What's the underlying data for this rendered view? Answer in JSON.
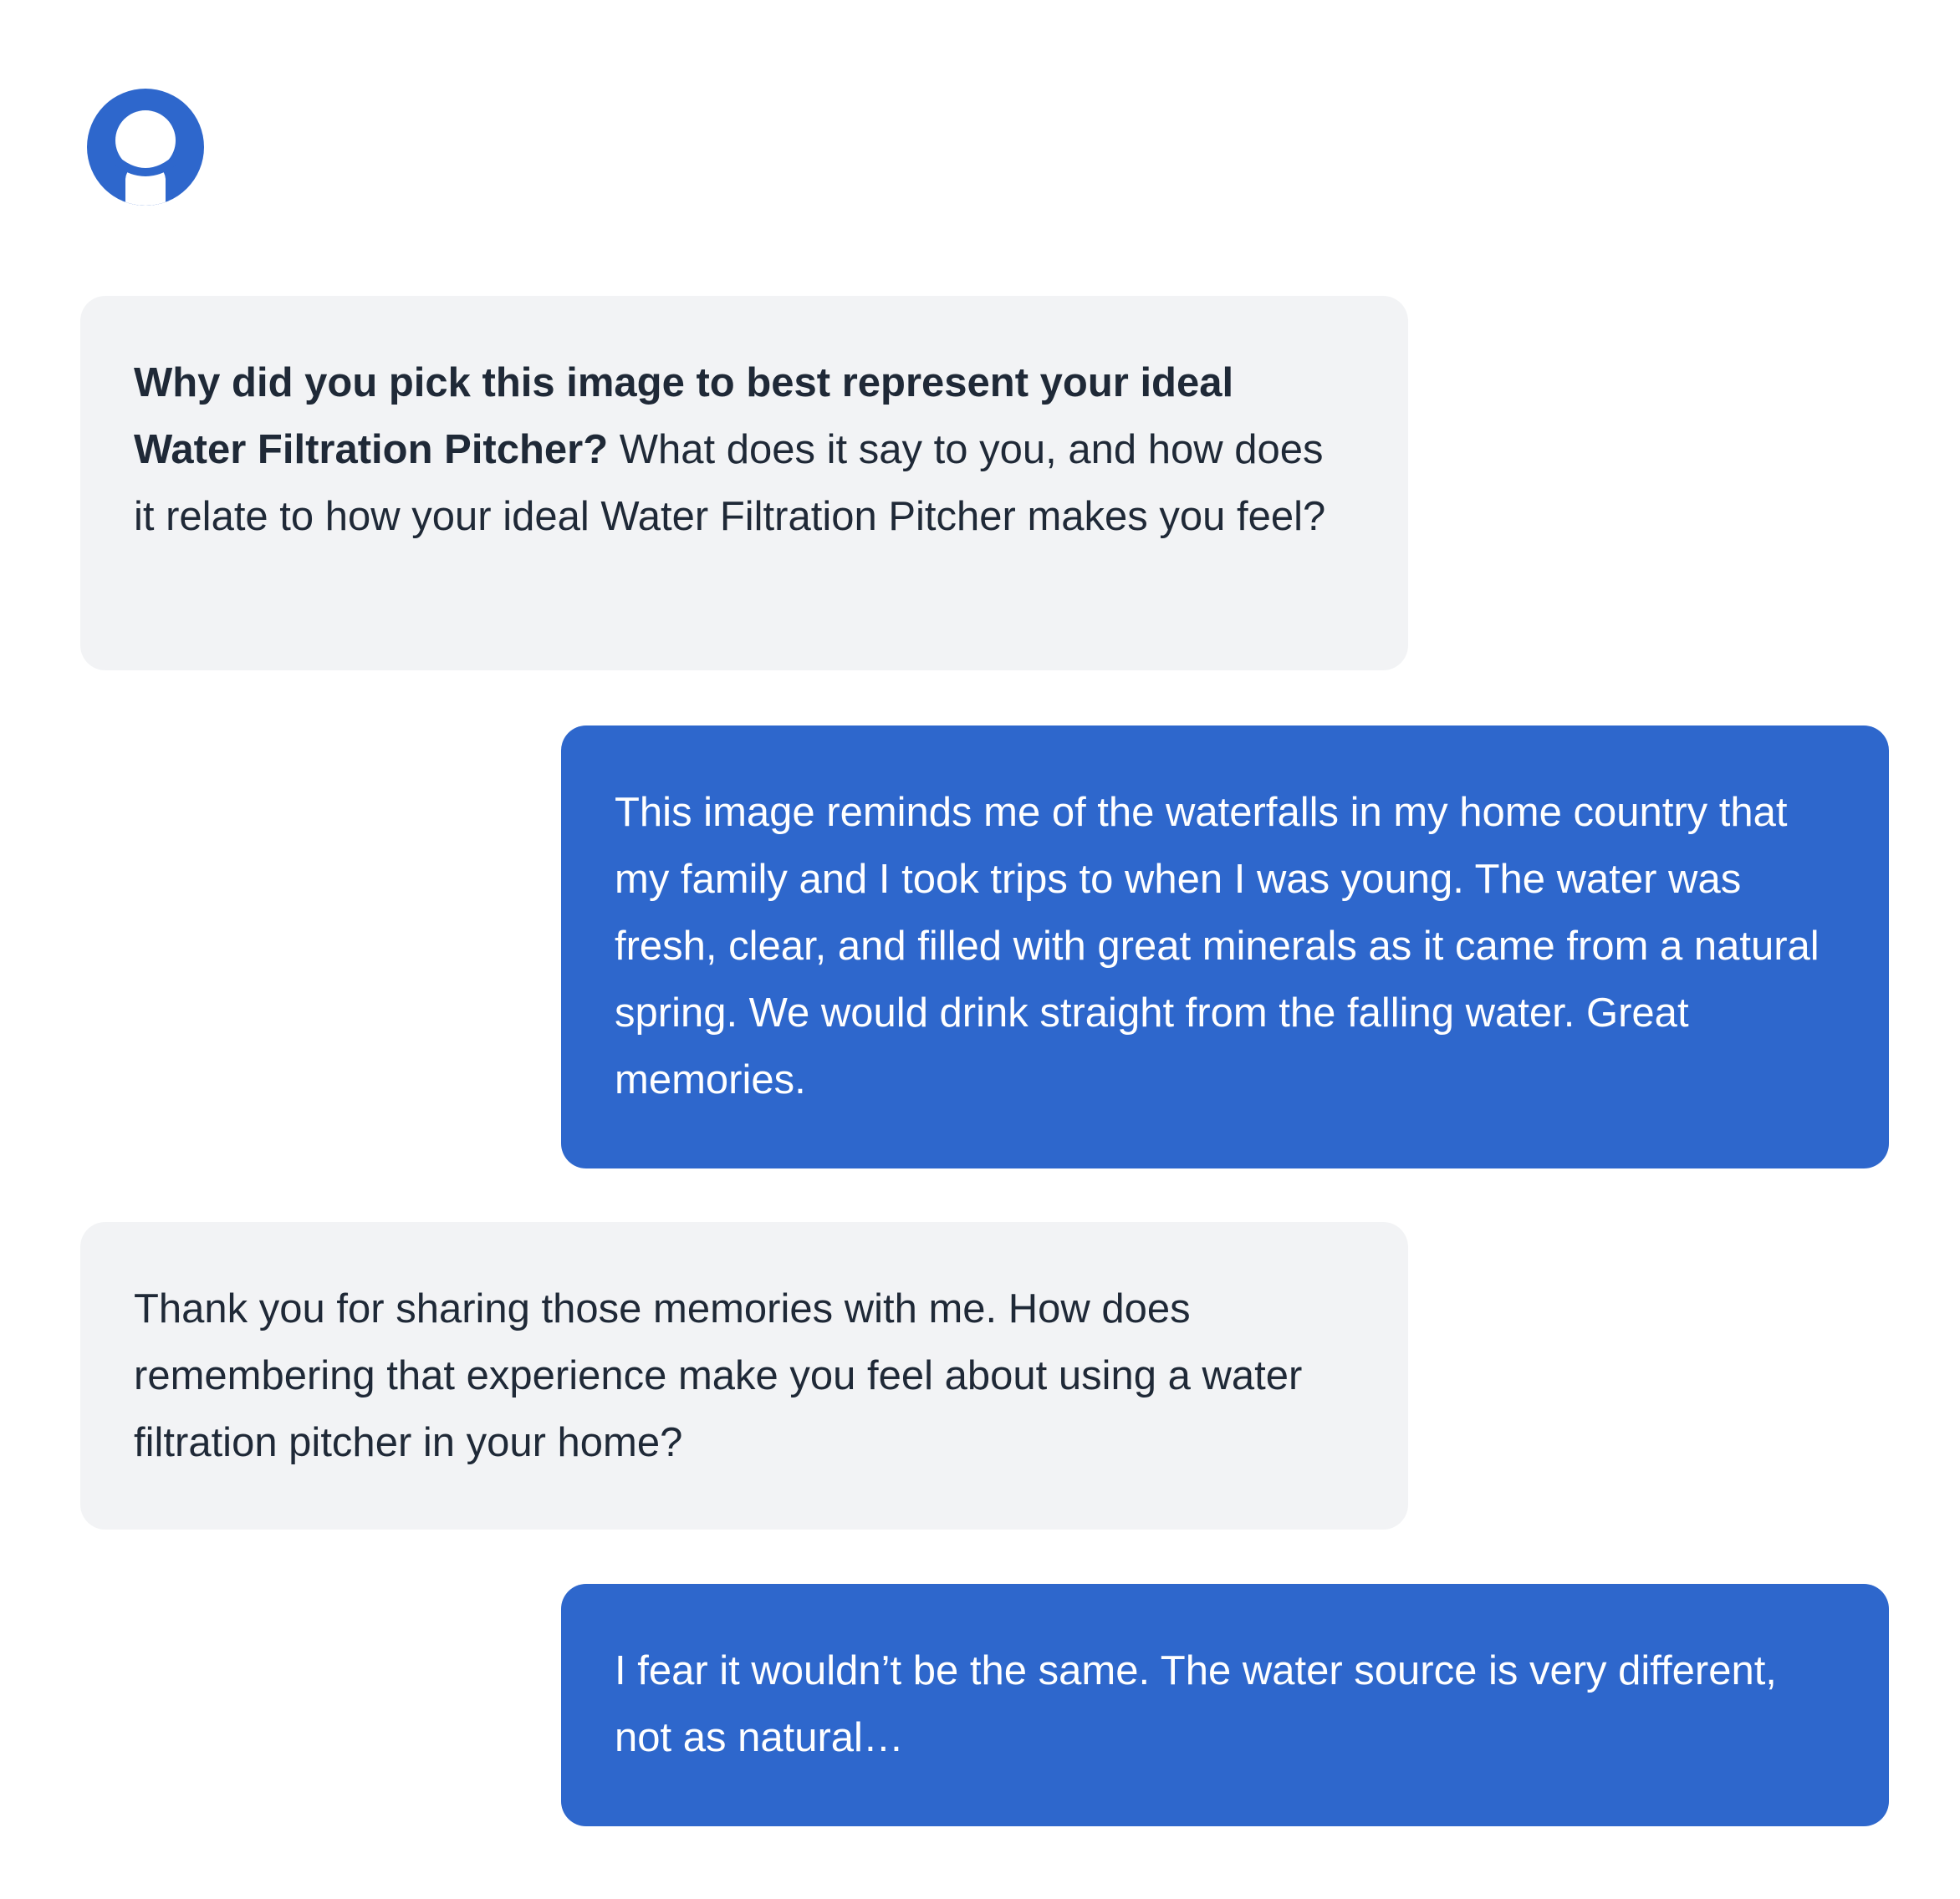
{
  "avatar": {
    "icon": "person-avatar-icon",
    "color": "#2e67cc"
  },
  "colors": {
    "bot_bubble_bg": "#f2f3f5",
    "bot_text": "#1f2937",
    "user_bubble_bg": "#2e67cc",
    "user_text": "#ffffff"
  },
  "messages": [
    {
      "sender": "bot",
      "bold": "Why did you pick this image to best represent your ideal Water Filtration Pitcher?",
      "text": " What does it say to you, and how does it relate to how your ideal Water Filtration Pitcher makes you feel?"
    },
    {
      "sender": "user",
      "text": "This image reminds me of the waterfalls in my home country that my family and I took trips to when I was young. The water was fresh, clear, and filled with great minerals as it came from a natural spring. We would drink straight from the falling water. Great memories."
    },
    {
      "sender": "bot",
      "text": "Thank you for sharing those memories with me. How does remembering that experience make you feel about using a water filtration pitcher in your home?"
    },
    {
      "sender": "user",
      "text": "I fear it wouldn’t be the same. The water source is very different, not as natural…"
    }
  ]
}
